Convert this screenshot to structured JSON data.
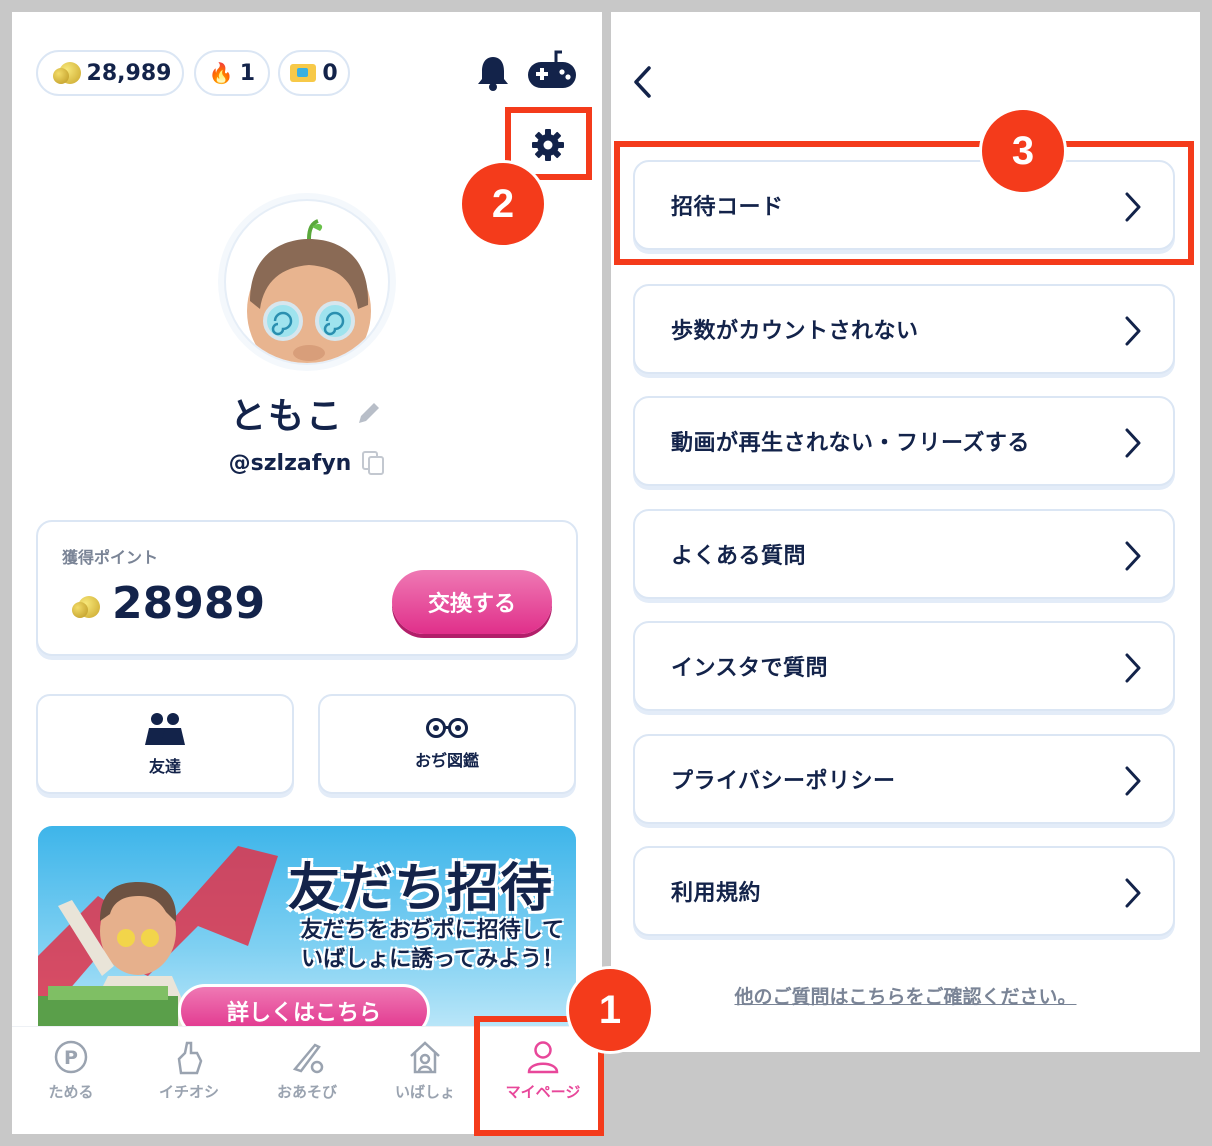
{
  "left": {
    "header": {
      "coins": "28,989",
      "streak": "1",
      "tickets": "0"
    },
    "profile": {
      "name": "ともこ",
      "handle": "@szlzafyn"
    },
    "points_card": {
      "label": "獲得ポイント",
      "value": "28989",
      "exchange_label": "交換する"
    },
    "tiles": [
      {
        "label": "友達",
        "icon": "friends-icon"
      },
      {
        "label": "おぢ図鑑",
        "icon": "glasses-icon"
      }
    ],
    "banner": {
      "title": "友だち招待",
      "line1": "友だちをおぢポに招待して",
      "line2": "いばしょに誘ってみよう！",
      "button": "詳しくはこちら"
    },
    "tabbar": [
      {
        "label": "ためる",
        "icon": "p-coin-icon",
        "active": false
      },
      {
        "label": "イチオシ",
        "icon": "finger-heart-icon",
        "active": false
      },
      {
        "label": "おあそび",
        "icon": "baseball-icon",
        "active": false
      },
      {
        "label": "いばしょ",
        "icon": "house-icon",
        "active": false
      },
      {
        "label": "マイページ",
        "icon": "person-icon",
        "active": true
      }
    ]
  },
  "annotations": {
    "step1": "1",
    "step2": "2",
    "step3": "3",
    "highlight_color": "#f43b1b"
  },
  "right": {
    "menu": [
      {
        "label": "招待コード"
      },
      {
        "label": "歩数がカウントされない"
      },
      {
        "label": "動画が再生されない・フリーズする"
      },
      {
        "label": "よくある質問"
      },
      {
        "label": "インスタで質問"
      },
      {
        "label": "プライバシーポリシー"
      },
      {
        "label": "利用規約"
      }
    ],
    "footer_link": "他のご質問はこちらをご確認ください。"
  },
  "colors": {
    "navy": "#13234a",
    "pink": "#e8479a",
    "border": "#dbe6f4"
  }
}
